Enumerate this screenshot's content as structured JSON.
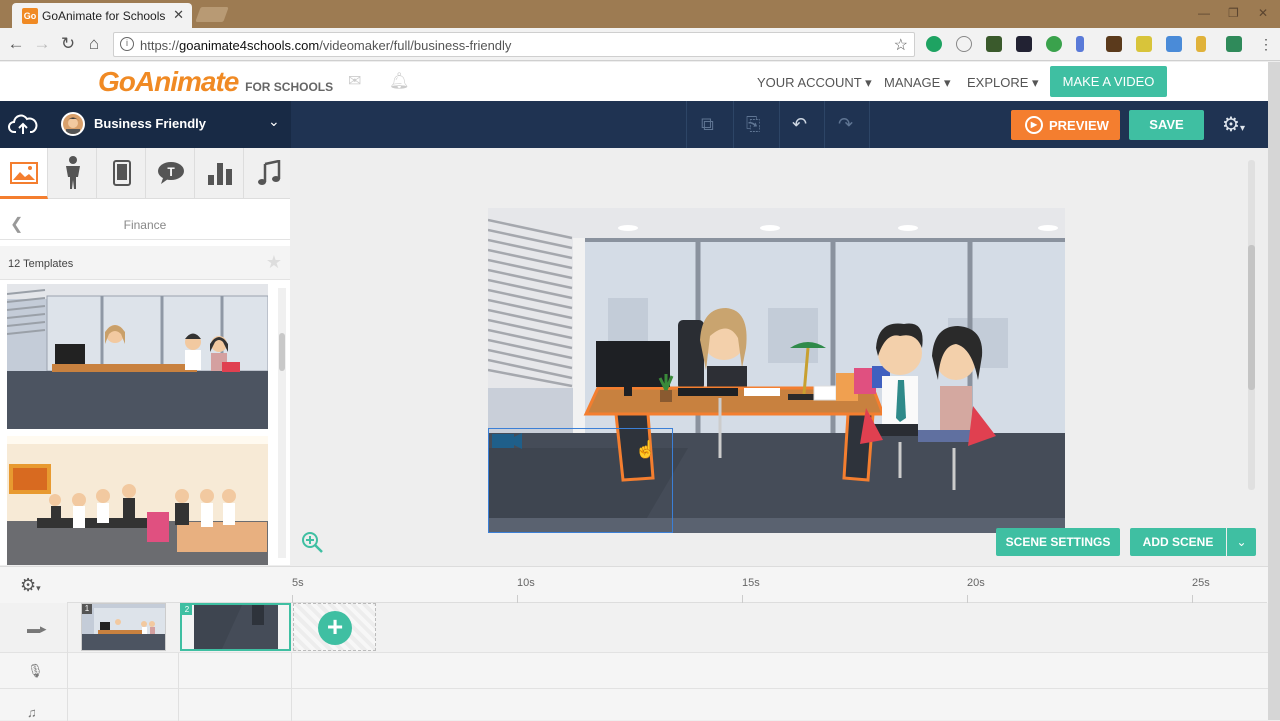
{
  "browser": {
    "tab_title": "GoAnimate for Schools",
    "tab_favicon": "Go",
    "url_prefix": "https://",
    "url_domain": "goanimate4schools.com",
    "url_path": "/videomaker/full/business-friendly",
    "window_controls": [
      "—",
      "❐",
      "✕"
    ]
  },
  "header": {
    "logo_main": "GoAnimate",
    "logo_sub": "FOR SCHOOLS",
    "nav": [
      {
        "label": "YOUR ACCOUNT ▾"
      },
      {
        "label": "MANAGE ▾"
      },
      {
        "label": "EXPLORE ▾"
      }
    ],
    "cta": "MAKE A VIDEO"
  },
  "toolbar": {
    "theme_name": "Business Friendly",
    "preview_label": "PREVIEW",
    "save_label": "SAVE"
  },
  "left_panel": {
    "asset_tabs": [
      "scenes-icon",
      "characters-icon",
      "props-icon",
      "text-icon",
      "charts-icon",
      "audio-icon"
    ],
    "category_title": "Finance",
    "template_count": "12 Templates"
  },
  "stage": {
    "scene_settings_label": "SCENE SETTINGS",
    "add_scene_label": "ADD SCENE"
  },
  "timeline": {
    "ticks": [
      "5s",
      "10s",
      "15s",
      "20s",
      "25s"
    ],
    "scenes": [
      {
        "number": "1"
      },
      {
        "number": "2"
      }
    ]
  },
  "colors": {
    "accent_teal": "#3fbfa2",
    "accent_orange": "#f47e2f",
    "toolbar_navy": "#1f3352"
  }
}
